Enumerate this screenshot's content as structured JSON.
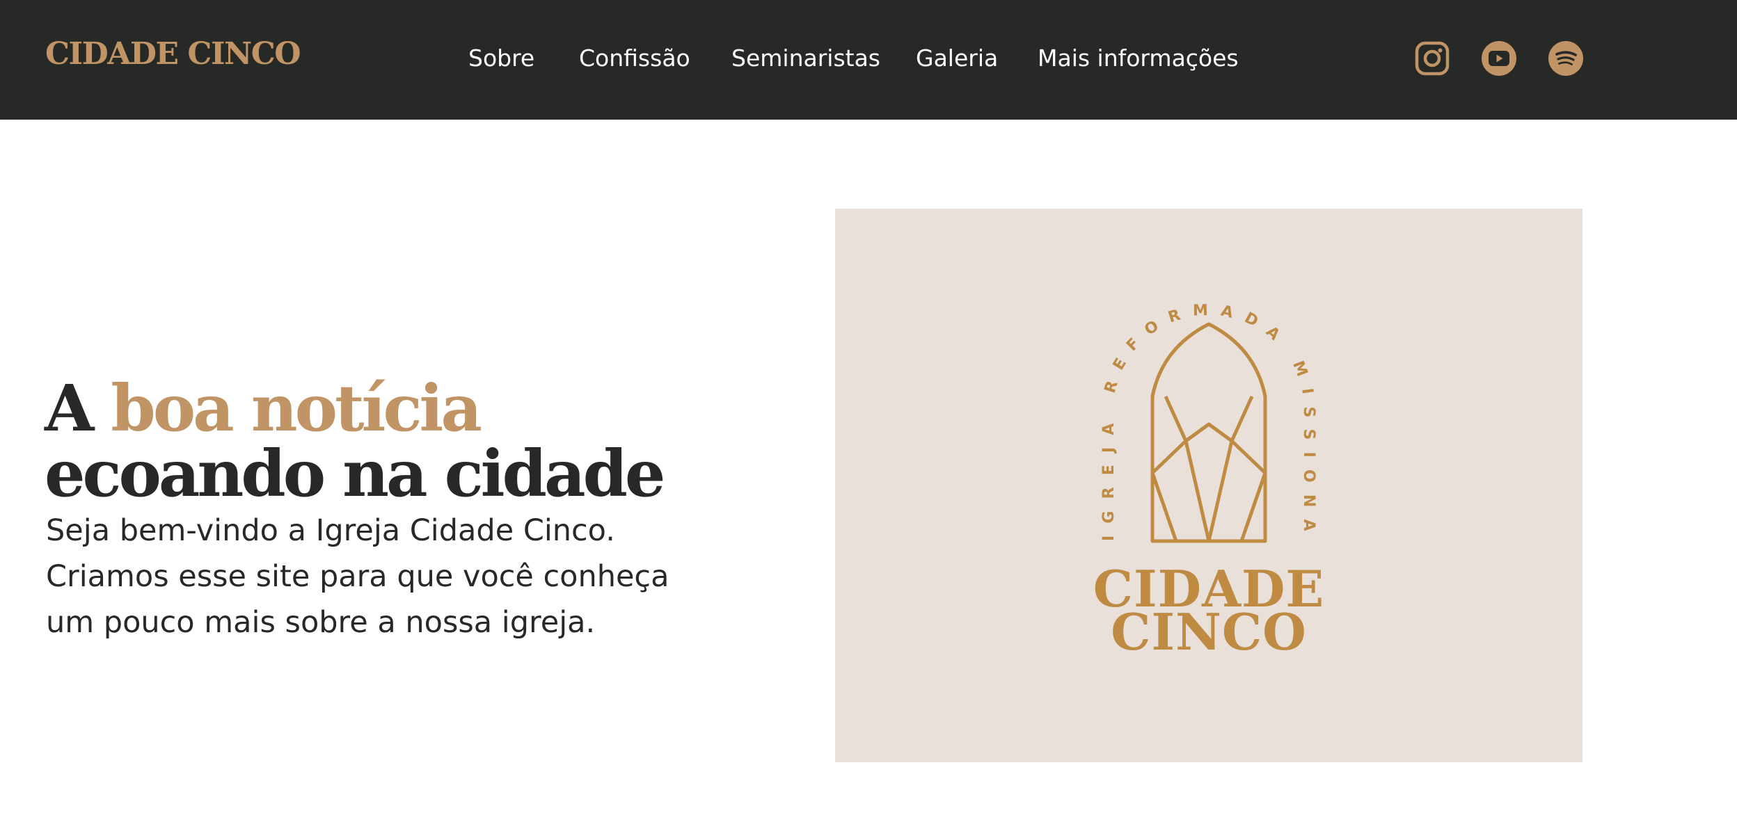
{
  "colors": {
    "accent": "#c19465",
    "logo_gold": "#bf8b43",
    "dark": "#272927",
    "header_bg": "#272927",
    "card_bg": "#e8e0d9"
  },
  "header": {
    "brand": "CIDADE CINCO",
    "nav": [
      "Sobre",
      "Confissão",
      "Seminaristas",
      "Galeria",
      "Mais informações"
    ],
    "social": [
      "instagram-icon",
      "youtube-icon",
      "spotify-icon"
    ]
  },
  "hero": {
    "title_prefix": "A ",
    "title_highlight": "boa notícia",
    "title_line2": "ecoando na cidade",
    "paragraph_lines": [
      "Seja bem-vindo a Igreja Cidade Cinco.",
      "Criamos esse site para que você conheça",
      "um pouco mais sobre a nossa igreja."
    ]
  },
  "logo": {
    "arc_text": "IGREJA REFORMADA MISSIONAL",
    "word1": "CIDADE",
    "word2": "CINCO"
  }
}
